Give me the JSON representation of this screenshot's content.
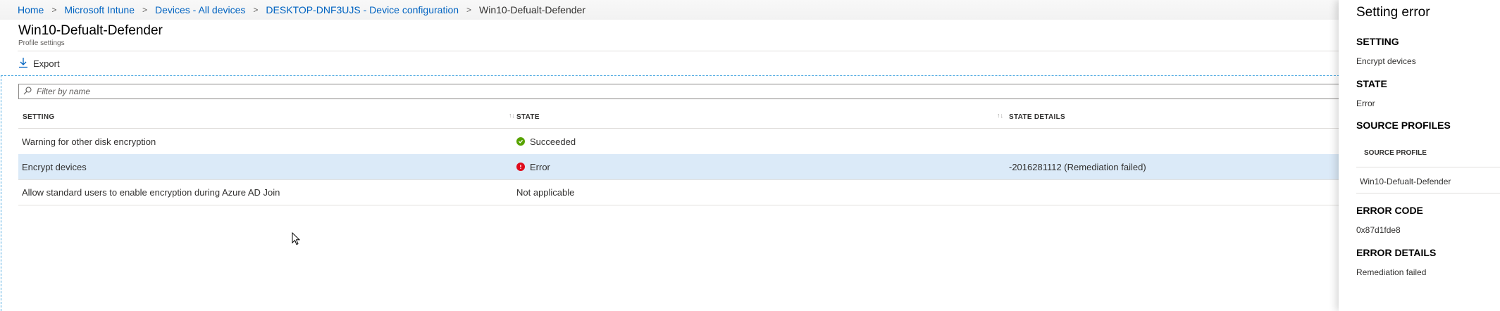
{
  "breadcrumb": {
    "items": [
      "Home",
      "Microsoft Intune",
      "Devices - All devices",
      "DESKTOP-DNF3UJS - Device configuration"
    ],
    "current": "Win10-Defualt-Defender",
    "separator": ">"
  },
  "page": {
    "title": "Win10-Defualt-Defender",
    "subtitle": "Profile settings"
  },
  "toolbar": {
    "export_label": "Export"
  },
  "filter": {
    "placeholder": "Filter by name",
    "value": ""
  },
  "table": {
    "headers": {
      "setting": "SETTING",
      "state": "STATE",
      "state_details": "STATE DETAILS"
    },
    "rows": [
      {
        "setting": "Warning for other disk encryption",
        "state": "Succeeded",
        "state_icon": "check-circle-icon",
        "details": ""
      },
      {
        "setting": "Encrypt devices",
        "state": "Error",
        "state_icon": "error-circle-icon",
        "details": "-2016281112 (Remediation failed)"
      },
      {
        "setting": "Allow standard users to enable encryption during Azure AD Join",
        "state": "Not applicable",
        "state_icon": "",
        "details": ""
      }
    ]
  },
  "panel": {
    "title": "Setting error",
    "setting_label": "SETTING",
    "setting_value": "Encrypt devices",
    "state_label": "STATE",
    "state_value": "Error",
    "source_profiles_label": "SOURCE PROFILES",
    "source_profile_header": "SOURCE PROFILE",
    "source_profile_value": "Win10-Defualt-Defender",
    "error_code_label": "ERROR CODE",
    "error_code_value": "0x87d1fde8",
    "error_details_label": "ERROR DETAILS",
    "error_details_value": "Remediation failed"
  },
  "colors": {
    "link": "#0063c1",
    "selected_row": "#dbeaf8",
    "success": "#57a300",
    "error": "#e00b1c"
  }
}
